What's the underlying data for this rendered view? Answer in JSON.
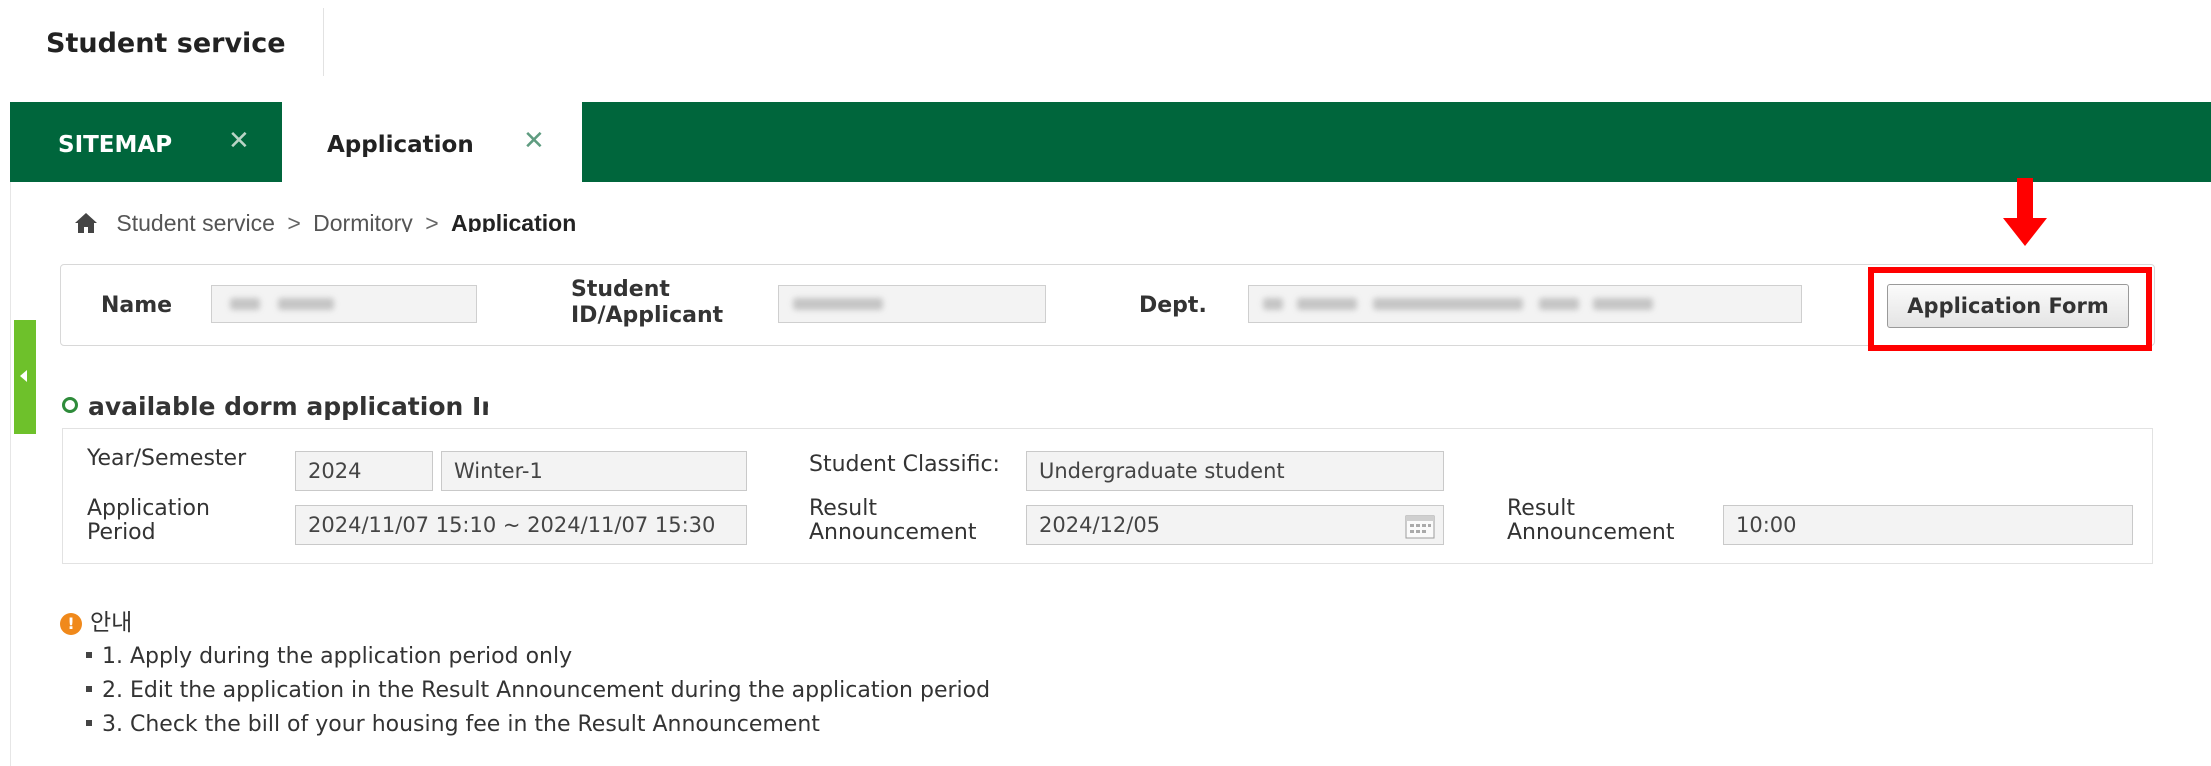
{
  "app": {
    "title": "Student service"
  },
  "tabs": [
    {
      "label": "SITEMAP",
      "close": "✕"
    },
    {
      "label": "Application",
      "close": "✕"
    }
  ],
  "breadcrumb": {
    "items": [
      "Student service",
      "Dormitory"
    ],
    "separator": ">",
    "current": "Application"
  },
  "student_info": {
    "name_label": "Name",
    "id_label_line1": "Student",
    "id_label_line2": "ID/Applicant",
    "dept_label": "Dept."
  },
  "buttons": {
    "application_form": "Application Form"
  },
  "section": {
    "title": "available dorm application Info"
  },
  "form": {
    "year_semester_label": "Year/Semester",
    "year": "2024",
    "semester": "Winter-1",
    "classification_label": "Student Classific:",
    "classification": "Undergraduate student",
    "period_label_line1": "Application",
    "period_label_line2": "Period",
    "period": "2024/11/07 15:10 ~ 2024/11/07 15:30",
    "result_label_line1": "Result",
    "result_label_line2": "Announcement",
    "result_date": "2024/12/05",
    "result_time": "10:00"
  },
  "notice": {
    "title": "안내",
    "items": [
      "1. Apply during the application period only",
      "2. Edit the application in the Result Announcement during the application period",
      "3. Check the bill of your housing fee in the Result Announcement"
    ]
  },
  "colors": {
    "tabbar": "#00663c",
    "highlight": "#ff0000",
    "side_handle": "#6ec12b",
    "section_bullet": "#2e8b3a",
    "info_icon": "#f0891b"
  }
}
